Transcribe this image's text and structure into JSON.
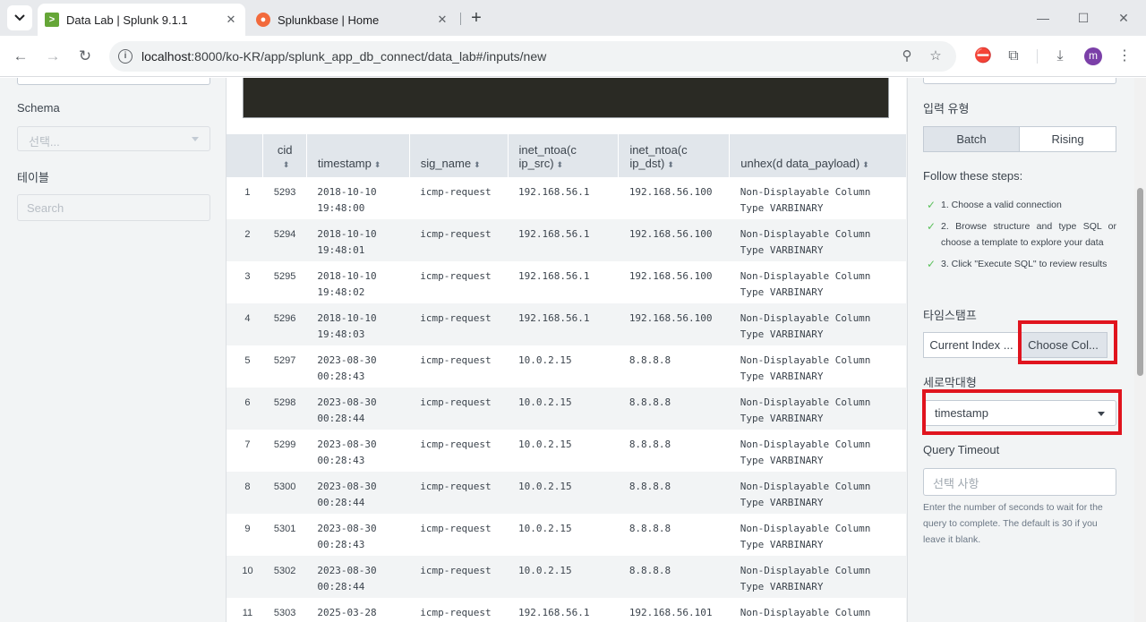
{
  "browser": {
    "tabs": [
      {
        "title": "Data Lab | Splunk 9.1.1",
        "favicon": "splunk-icon"
      },
      {
        "title": "Splunkbase | Home",
        "favicon": "splunkbase-icon"
      }
    ],
    "url_host": "localhost",
    "url_path": ":8000/ko-KR/app/splunk_app_db_connect/data_lab#/inputs/new",
    "avatar_letter": "m"
  },
  "left_panel": {
    "schema_label": "Schema",
    "schema_placeholder": "선택...",
    "table_label": "테이블",
    "search_placeholder": "Search"
  },
  "results": {
    "columns": [
      {
        "label": "",
        "key": "num"
      },
      {
        "label": "cid",
        "key": "cid"
      },
      {
        "label": "timestamp",
        "key": "timestamp"
      },
      {
        "label": "sig_name",
        "key": "sig_name"
      },
      {
        "label": "inet_ntoa(c ip_src)",
        "key": "ip_src"
      },
      {
        "label": "inet_ntoa(c ip_dst)",
        "key": "ip_dst"
      },
      {
        "label": "unhex(d data_payload)",
        "key": "payload"
      }
    ],
    "rows": [
      {
        "num": "1",
        "cid": "5293",
        "date": "2018-10-10",
        "time": "19:48:00",
        "sig_name": "icmp-request",
        "ip_src": "192.168.56.1",
        "ip_dst": "192.168.56.100",
        "payload1": "Non-Displayable Column",
        "payload2": "Type VARBINARY"
      },
      {
        "num": "2",
        "cid": "5294",
        "date": "2018-10-10",
        "time": "19:48:01",
        "sig_name": "icmp-request",
        "ip_src": "192.168.56.1",
        "ip_dst": "192.168.56.100",
        "payload1": "Non-Displayable Column",
        "payload2": "Type VARBINARY"
      },
      {
        "num": "3",
        "cid": "5295",
        "date": "2018-10-10",
        "time": "19:48:02",
        "sig_name": "icmp-request",
        "ip_src": "192.168.56.1",
        "ip_dst": "192.168.56.100",
        "payload1": "Non-Displayable Column",
        "payload2": "Type VARBINARY"
      },
      {
        "num": "4",
        "cid": "5296",
        "date": "2018-10-10",
        "time": "19:48:03",
        "sig_name": "icmp-request",
        "ip_src": "192.168.56.1",
        "ip_dst": "192.168.56.100",
        "payload1": "Non-Displayable Column",
        "payload2": "Type VARBINARY"
      },
      {
        "num": "5",
        "cid": "5297",
        "date": "2023-08-30",
        "time": "00:28:43",
        "sig_name": "icmp-request",
        "ip_src": "10.0.2.15",
        "ip_dst": "8.8.8.8",
        "payload1": "Non-Displayable Column",
        "payload2": "Type VARBINARY"
      },
      {
        "num": "6",
        "cid": "5298",
        "date": "2023-08-30",
        "time": "00:28:44",
        "sig_name": "icmp-request",
        "ip_src": "10.0.2.15",
        "ip_dst": "8.8.8.8",
        "payload1": "Non-Displayable Column",
        "payload2": "Type VARBINARY"
      },
      {
        "num": "7",
        "cid": "5299",
        "date": "2023-08-30",
        "time": "00:28:43",
        "sig_name": "icmp-request",
        "ip_src": "10.0.2.15",
        "ip_dst": "8.8.8.8",
        "payload1": "Non-Displayable Column",
        "payload2": "Type VARBINARY"
      },
      {
        "num": "8",
        "cid": "5300",
        "date": "2023-08-30",
        "time": "00:28:44",
        "sig_name": "icmp-request",
        "ip_src": "10.0.2.15",
        "ip_dst": "8.8.8.8",
        "payload1": "Non-Displayable Column",
        "payload2": "Type VARBINARY"
      },
      {
        "num": "9",
        "cid": "5301",
        "date": "2023-08-30",
        "time": "00:28:43",
        "sig_name": "icmp-request",
        "ip_src": "10.0.2.15",
        "ip_dst": "8.8.8.8",
        "payload1": "Non-Displayable Column",
        "payload2": "Type VARBINARY"
      },
      {
        "num": "10",
        "cid": "5302",
        "date": "2023-08-30",
        "time": "00:28:44",
        "sig_name": "icmp-request",
        "ip_src": "10.0.2.15",
        "ip_dst": "8.8.8.8",
        "payload1": "Non-Displayable Column",
        "payload2": "Type VARBINARY"
      },
      {
        "num": "11",
        "cid": "5303",
        "date": "2025-03-28",
        "time": "",
        "sig_name": "icmp-request",
        "ip_src": "192.168.56.1",
        "ip_dst": "192.168.56.101",
        "payload1": "Non-Displayable Column",
        "payload2": ""
      }
    ]
  },
  "right_panel": {
    "input_type_label": "입력 유형",
    "input_type_options": [
      "Batch",
      "Rising"
    ],
    "input_type_selected": "Batch",
    "steps_title": "Follow these steps:",
    "steps": [
      "1. Choose a valid connection",
      "2. Browse structure and type SQL or choose a template to explore your data",
      "3. Click \"Execute SQL\" to review results"
    ],
    "timestamp_label": "타임스탬프",
    "timestamp_options": [
      "Current Index ...",
      "Choose Col..."
    ],
    "timestamp_selected": "Choose Col...",
    "column_label": "세로막대형",
    "column_value": "timestamp",
    "query_timeout_label": "Query Timeout",
    "query_timeout_placeholder": "선택 사항",
    "query_timeout_help": "Enter the number of seconds to wait for the query to complete. The default is 30 if you leave it blank."
  },
  "colors": {
    "highlight": "#e0141e",
    "step_check": "#5cc05c",
    "selected_segment": "#dfe4ea"
  }
}
